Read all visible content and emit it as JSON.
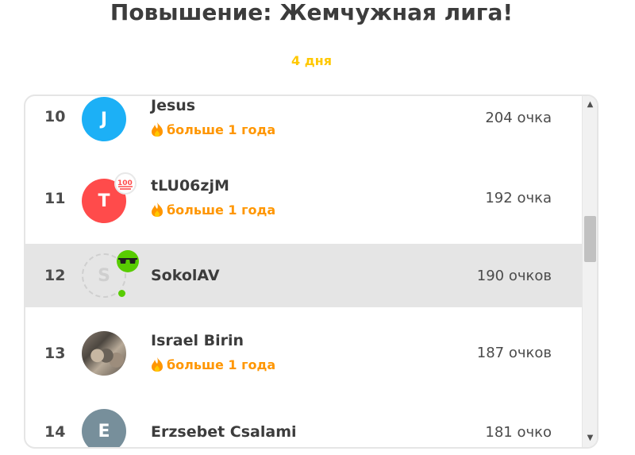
{
  "header": {
    "title": "Повышение: Жемчужная лига!",
    "days_left": "4 дня"
  },
  "leaderboard": [
    {
      "rank": "10",
      "avatar_letter": "J",
      "avatar_color": "#1cb0f6",
      "name": "Jesus",
      "streak": "больше 1 года",
      "score": "204 очка"
    },
    {
      "rank": "11",
      "avatar_letter": "T",
      "avatar_color": "#ff4b4b",
      "badge_icon": "hundred-icon",
      "name": "tLU06zjM",
      "streak": "больше 1 года",
      "score": "192 очка"
    },
    {
      "rank": "12",
      "avatar_letter": "S",
      "avatar_color": "#cfcfcf",
      "badge_icon": "sunglasses-icon",
      "name": "SokolAV",
      "score": "190 очков",
      "current_user": true
    },
    {
      "rank": "13",
      "avatar_letter": "",
      "avatar_color": "photo",
      "name": "Israel Birin",
      "streak": "больше 1 года",
      "score": "187 очков"
    },
    {
      "rank": "14",
      "avatar_letter": "E",
      "avatar_color": "#778f9b",
      "name": "Erzsebet Csalami",
      "score": "181 очко"
    }
  ],
  "scrollbar": {
    "up_icon": "scroll-up-icon",
    "down_icon": "scroll-down-icon",
    "thumb_position": 0.35
  },
  "colors": {
    "title": "#3c3c3c",
    "days": "#ffc800",
    "streak": "#ff9600",
    "current_row": "#e5e5e5",
    "online": "#58cc02"
  }
}
